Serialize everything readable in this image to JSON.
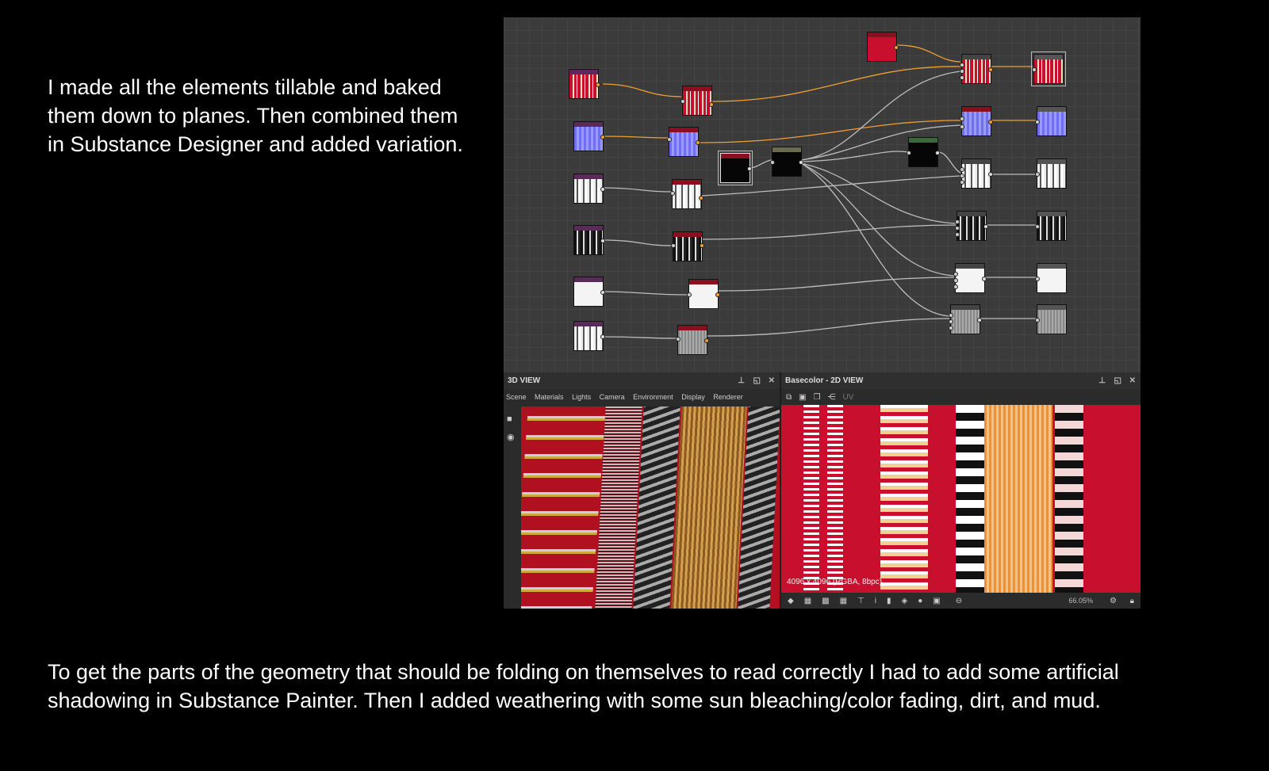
{
  "captions": {
    "top": "I made all the elements tillable and baked them down to planes. Then combined them in Substance Designer and added variation.",
    "bottom": "To get the parts of the geometry that should be folding on themselves to read correctly I had to add some artificial shadowing in Substance Painter. Then I added weathering with some sun bleaching/color fading, dirt, and mud."
  },
  "view3d": {
    "title": "3D VIEW",
    "menu": [
      "Scene",
      "Materials",
      "Lights",
      "Camera",
      "Environment",
      "Display",
      "Renderer"
    ]
  },
  "view2d": {
    "title": "Basecolor - 2D VIEW",
    "uv_label": "UV",
    "resolution": "4096 x 4096 (RGBA, 8bpc)",
    "zoom": "66.05%"
  },
  "colors": {
    "accent_red": "#c8102e",
    "wire_orange": "#f0a030",
    "wire_grey": "#bdbdbd",
    "graph_bg": "#3b3b3b"
  },
  "icons": [
    "pin-icon",
    "maximize-icon",
    "close-icon",
    "camera-icon",
    "light-bulb-icon",
    "layers-icon",
    "save-icon",
    "copy-icon",
    "share-icon",
    "zoom-out-icon",
    "gear-icon",
    "lock-icon"
  ]
}
